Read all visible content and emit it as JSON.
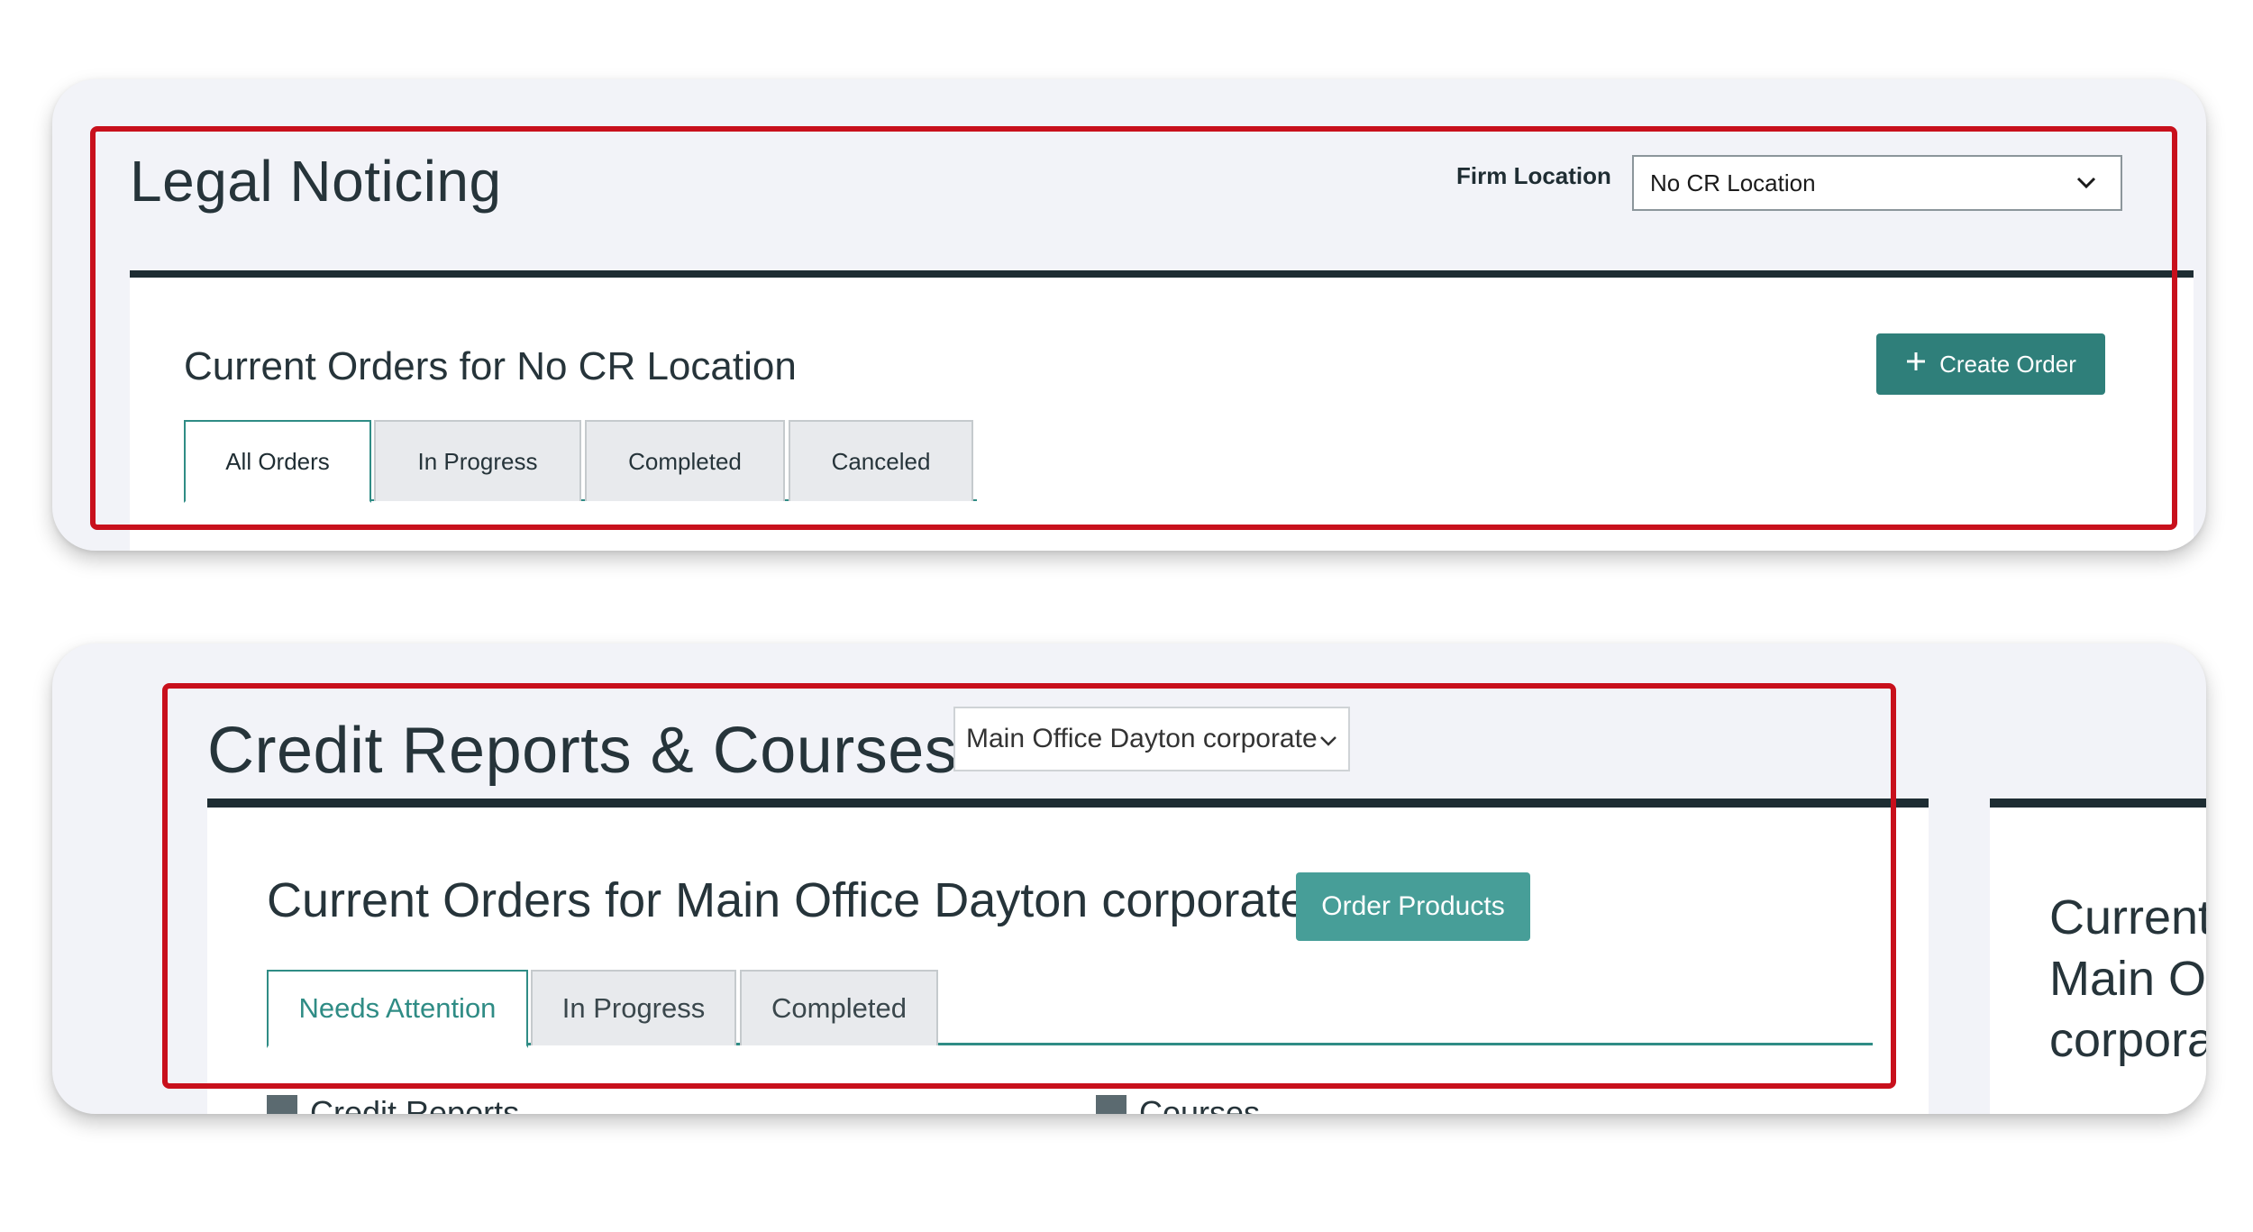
{
  "legal": {
    "title": "Legal Noticing",
    "firm_location_label": "Firm Location",
    "firm_location_value": "No CR Location",
    "current_orders_title": "Current Orders for No CR Location",
    "create_order_label": "Create Order",
    "tabs": [
      {
        "label": "All Orders",
        "active": true
      },
      {
        "label": "In Progress",
        "active": false
      },
      {
        "label": "Completed",
        "active": false
      },
      {
        "label": "Canceled",
        "active": false
      }
    ]
  },
  "credit": {
    "title": "Credit Reports & Courses",
    "location_value": "Main Office Dayton corporate",
    "current_orders_title": "Current Orders for Main Office Dayton corporate",
    "order_products_label": "Order Products",
    "tabs": [
      {
        "label": "Needs Attention",
        "active": true
      },
      {
        "label": "In Progress",
        "active": false
      },
      {
        "label": "Completed",
        "active": false
      }
    ],
    "sections": [
      "Credit Reports",
      "Courses"
    ],
    "side_panel_lines": [
      "Current",
      "Main Of",
      "corpora"
    ]
  },
  "colors": {
    "highlight": "#c8101c",
    "teal_button": "#2f7f7a",
    "teal_button_light": "#479e98",
    "header_bar": "#1e2d33"
  },
  "icons": {
    "plus": "plus-icon",
    "chevron": "chevron-down-icon",
    "document": "document-icon",
    "courses": "courses-icon"
  }
}
